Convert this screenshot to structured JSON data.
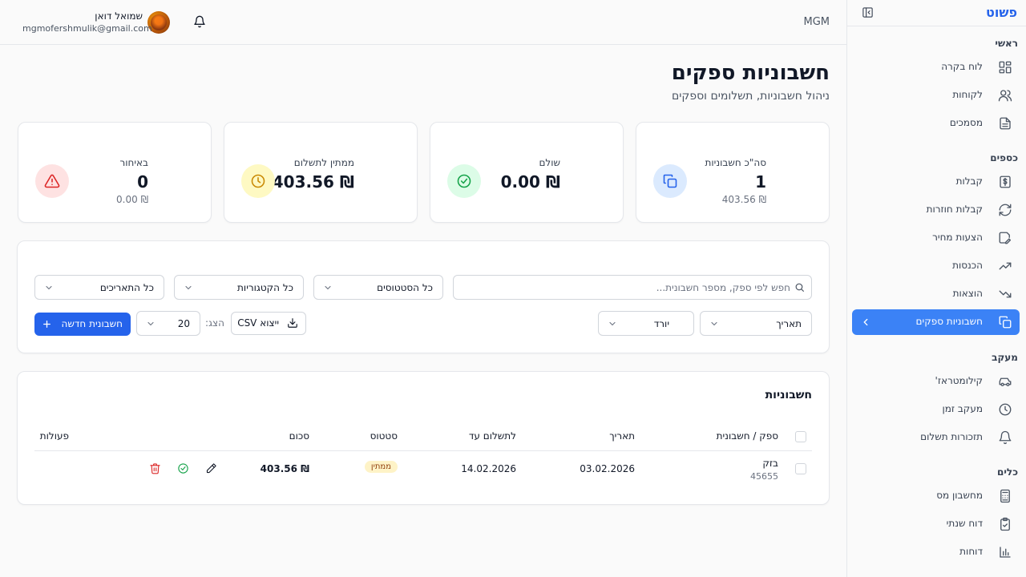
{
  "sidebar": {
    "brand": "פשוט",
    "groups": [
      {
        "label": "ראשי",
        "items": [
          {
            "label": "לוח בקרה",
            "icon": "dashboard-icon"
          },
          {
            "label": "לקוחות",
            "icon": "users-icon"
          },
          {
            "label": "מסמכים",
            "icon": "document-icon"
          }
        ]
      },
      {
        "label": "כספים",
        "items": [
          {
            "label": "קבלות",
            "icon": "dollar-receipt-icon"
          },
          {
            "label": "קבלות חוזרות",
            "icon": "refresh-icon"
          },
          {
            "label": "הצעות מחיר",
            "icon": "quote-edit-icon"
          },
          {
            "label": "הכנסות",
            "icon": "trending-up-icon"
          },
          {
            "label": "הוצאות",
            "icon": "trending-down-icon"
          },
          {
            "label": "חשבוניות ספקים",
            "icon": "copy-icon",
            "active": true
          }
        ]
      },
      {
        "label": "מעקב",
        "items": [
          {
            "label": "קילומטראז'",
            "icon": "car-icon"
          },
          {
            "label": "מעקב זמן",
            "icon": "clock-icon"
          },
          {
            "label": "תזכורות תשלום",
            "icon": "bell-icon"
          }
        ]
      },
      {
        "label": "כלים",
        "items": [
          {
            "label": "מחשבון מס",
            "icon": "calculator-icon"
          },
          {
            "label": "דוח שנתי",
            "icon": "clipboard-check-icon"
          },
          {
            "label": "דוחות",
            "icon": "bar-chart-icon"
          }
        ]
      }
    ]
  },
  "topbar": {
    "org": "MGM",
    "user_name": "שמואל דואן",
    "user_email": "mgmofershmulik@gmail.com"
  },
  "page": {
    "title": "חשבוניות ספקים",
    "subtitle": "ניהול חשבוניות, תשלומים וספקים"
  },
  "stats": [
    {
      "label": "סה\"כ חשבוניות",
      "value": "1",
      "sub": "₪ 403.56",
      "icon": "copy-icon",
      "color": "#2563eb",
      "bg": "#dbeafe"
    },
    {
      "label": "שולם",
      "value": "₪ 0.00",
      "sub": "",
      "icon": "check-circle-icon",
      "color": "#16a34a",
      "bg": "#dcfce7"
    },
    {
      "label": "ממתין לתשלום",
      "value": "₪ 403.56",
      "sub": "",
      "icon": "clock-icon",
      "color": "#ca8a04",
      "bg": "#fef9c3"
    },
    {
      "label": "באיחור",
      "value": "0",
      "sub": "₪ 0.00",
      "icon": "alert-triangle-icon",
      "color": "#dc2626",
      "bg": "#fee2e2"
    }
  ],
  "filters": {
    "search_placeholder": "חפש לפי ספק, מספר חשבונית...",
    "status": "כל הסטטוסים",
    "category": "כל הקטגוריות",
    "dates": "כל התאריכים",
    "sort_field": "תאריך",
    "sort_dir": "יורד",
    "export_label": "ייצוא CSV",
    "show_label": "הצג:",
    "page_size": "20",
    "new_label": "חשבונית חדשה"
  },
  "table": {
    "title": "חשבוניות",
    "headers": {
      "supplier": "ספק / חשבונית",
      "date": "תאריך",
      "due": "לתשלום עד",
      "status": "סטטוס",
      "amount": "סכום",
      "actions": "פעולות"
    },
    "rows": [
      {
        "supplier": "בזק",
        "invoice_no": "45655",
        "date": "03.02.2026",
        "due": "14.02.2026",
        "status": "ממתין",
        "amount": "₪ 403.56"
      }
    ]
  }
}
